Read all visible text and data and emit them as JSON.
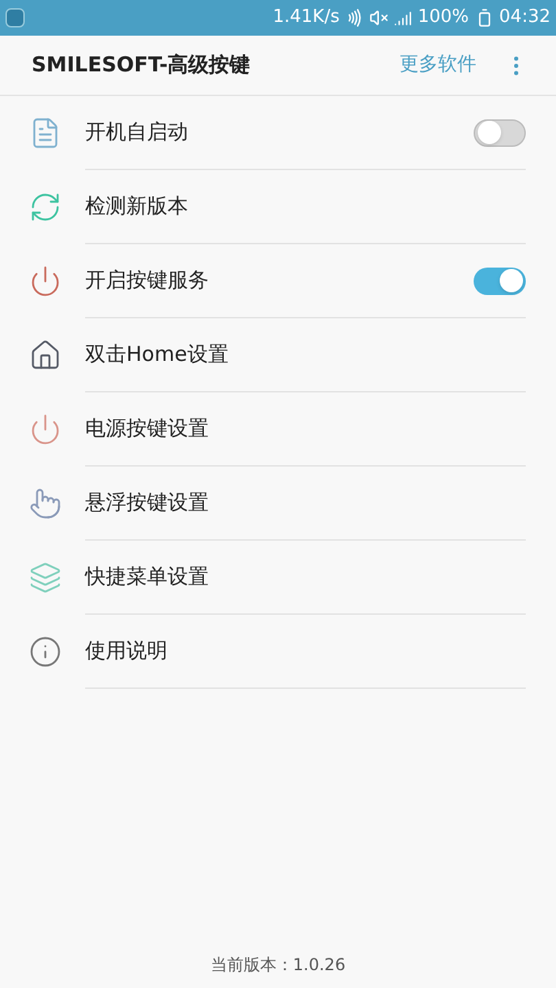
{
  "status_bar": {
    "speed": "1.41K/s",
    "battery": "100%",
    "time": "04:32"
  },
  "app_bar": {
    "title": "SMILESOFT-高级按键",
    "action": "更多软件"
  },
  "items": [
    {
      "label": "开机自启动",
      "kind": "toggle",
      "on": false
    },
    {
      "label": "检测新版本",
      "kind": "link"
    },
    {
      "label": "开启按键服务",
      "kind": "toggle",
      "on": true
    },
    {
      "label": "双击Home设置",
      "kind": "link"
    },
    {
      "label": "电源按键设置",
      "kind": "link"
    },
    {
      "label": "悬浮按键设置",
      "kind": "link"
    },
    {
      "label": "快捷菜单设置",
      "kind": "link"
    },
    {
      "label": "使用说明",
      "kind": "link"
    }
  ],
  "footer": "当前版本：1.0.26"
}
